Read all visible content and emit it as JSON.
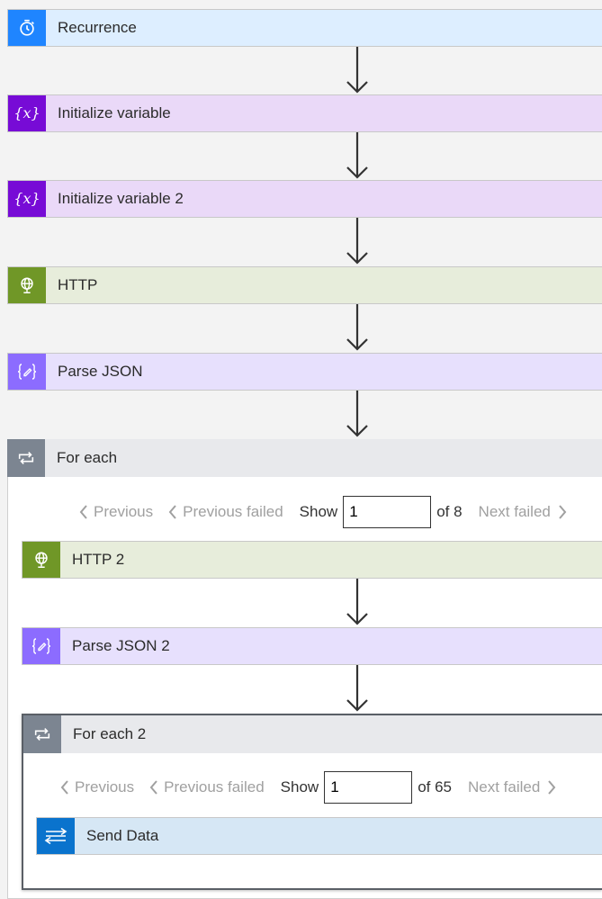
{
  "steps": {
    "recurrence": "Recurrence",
    "init_var": "Initialize variable",
    "init_var2": "Initialize variable 2",
    "http": "HTTP",
    "parse_json": "Parse JSON",
    "for_each": "For each",
    "http2": "HTTP 2",
    "parse_json2": "Parse JSON 2",
    "for_each2": "For each 2",
    "send_data": "Send Data"
  },
  "pager1": {
    "previous": "Previous",
    "previous_failed": "Previous failed",
    "show": "Show",
    "value": "1",
    "of": "of 8",
    "next_failed": "Next failed"
  },
  "pager2": {
    "previous": "Previous",
    "previous_failed": "Previous failed",
    "show": "Show",
    "value": "1",
    "of": "of 65",
    "next_failed": "Next failed"
  },
  "colors": {
    "recurrence_bg": "#ddeeff",
    "recurrence_icon": "#1f85ff",
    "variable_bg": "#ead9f8",
    "variable_icon": "#770bd6",
    "http_bg": "#e7eddb",
    "http_icon": "#709727",
    "parse_bg": "#e7e0fd",
    "parse_icon": "#8c6cff",
    "foreach_bg": "#e8e9ec",
    "foreach_icon": "#7c8591",
    "senddata_bg": "#d6e7f5",
    "senddata_icon": "#0a73cd"
  },
  "icons": {
    "recurrence": "alarm-clock-icon",
    "variable": "curly-braces-x-icon",
    "http": "globe-icon",
    "parse_json": "curly-braces-pencil-icon",
    "for_each": "loop-icon",
    "send_data": "transfer-arrows-icon"
  }
}
